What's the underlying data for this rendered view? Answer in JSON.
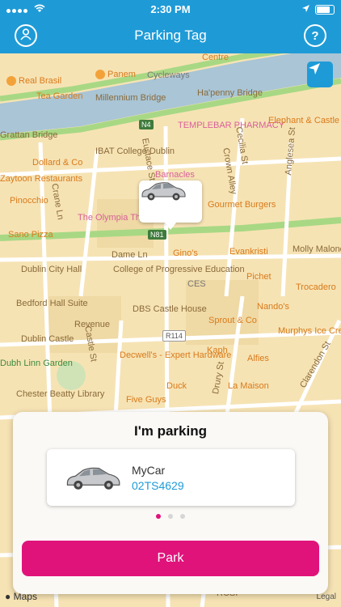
{
  "status_bar": {
    "time": "2:30 PM"
  },
  "nav": {
    "title": "Parking Tag",
    "help_label": "?"
  },
  "map": {
    "road_signs": [
      "N4",
      "N81",
      "R114"
    ],
    "labels": [
      "Centre",
      "Real Brasil",
      "Panem",
      "Cycleways",
      "Tea Garden",
      "Millennium Bridge",
      "Ha'penny Bridge",
      "Elephant & Castle",
      "Grattan Bridge",
      "TEMPLEBAR PHARMACY",
      "IBAT College Dublin",
      "Dollard & Co",
      "Zaytoon Restaurants",
      "Barnacles",
      "Pinocchio",
      "The Olympia Theatre",
      "Gourmet Burgers",
      "Sano Pizza",
      "Gino's",
      "Evankristi",
      "Molly Malone Statue",
      "Dublin City Hall",
      "College of Progressive Education",
      "CES",
      "Pichet",
      "Trocadero",
      "Bedford Hall Suite",
      "DBS Castle House",
      "Nando's",
      "Revenue",
      "Sprout & Co",
      "Murphys Ice Cream",
      "Dublin Castle",
      "Kaph",
      "Decwell's - Expert Hardware",
      "Alfies",
      "Dubh Linn Garden",
      "Duck",
      "La Maison",
      "Chester Beatty Library",
      "Five Guys",
      "Dame Ln",
      "Crown Alley",
      "Anglesea St",
      "Castle St",
      "Drury St",
      "Clarendon St",
      "Eustace St",
      "Cecilia St",
      "Crane Ln",
      "RCSI"
    ],
    "legal": "Legal",
    "brand": "Maps"
  },
  "sheet": {
    "title": "I'm parking",
    "vehicle": {
      "name": "MyCar",
      "plate": "02TS4629"
    },
    "pager_active": 0,
    "park_label": "Park"
  },
  "colors": {
    "primary": "#1e9bd7",
    "accent": "#e0137b",
    "map_bg": "#f6e3b4",
    "road": "#ffffff",
    "river": "#a9c5d6",
    "main_road": "#a8d884"
  }
}
